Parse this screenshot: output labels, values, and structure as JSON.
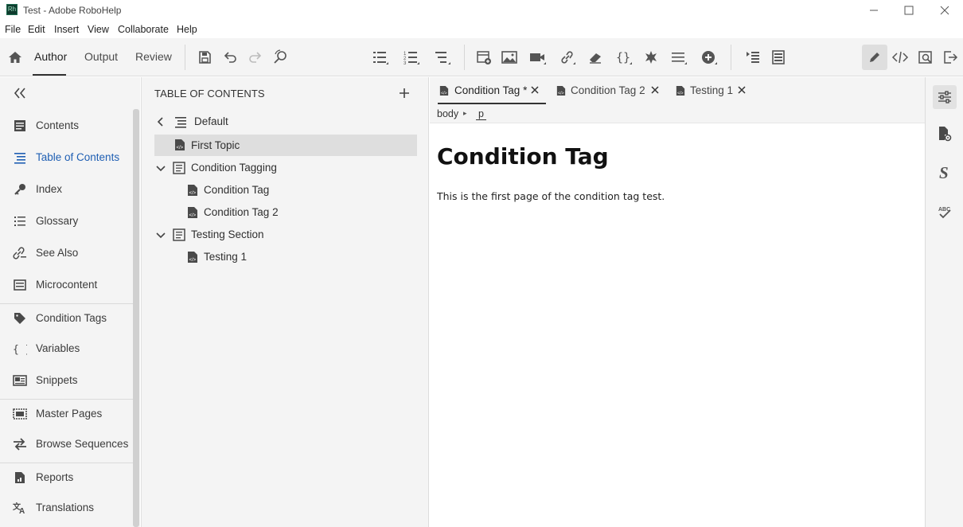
{
  "window": {
    "title": "Test - Adobe RoboHelp",
    "logo_text": "Rh"
  },
  "menu": [
    "File",
    "Edit",
    "Insert",
    "View",
    "Collaborate",
    "Help"
  ],
  "toolbar": {
    "tabs": [
      "Author",
      "Output",
      "Review"
    ],
    "active_tab": "Author"
  },
  "left_nav": {
    "items": [
      {
        "label": "Contents",
        "icon": "contents-icon"
      },
      {
        "label": "Table of Contents",
        "icon": "toc-icon",
        "active": true
      },
      {
        "label": "Index",
        "icon": "key-icon"
      },
      {
        "label": "Glossary",
        "icon": "glossary-icon"
      },
      {
        "label": "See Also",
        "icon": "see-also-icon"
      },
      {
        "label": "Microcontent",
        "icon": "microcontent-icon"
      },
      {
        "label": "Condition Tags",
        "icon": "tag-icon"
      },
      {
        "label": "Variables",
        "icon": "braces-icon"
      },
      {
        "label": "Snippets",
        "icon": "snippets-icon"
      },
      {
        "label": "Master Pages",
        "icon": "master-pages-icon"
      },
      {
        "label": "Browse Sequences",
        "icon": "browse-sequences-icon"
      },
      {
        "label": "Reports",
        "icon": "reports-icon"
      },
      {
        "label": "Translations",
        "icon": "translations-icon"
      }
    ],
    "active_color": "#1f5fb3"
  },
  "toc_panel": {
    "title": "TABLE OF CONTENTS",
    "root": "Default",
    "rows": [
      {
        "label": "First Topic",
        "type": "topic",
        "level": 0,
        "selected": true
      },
      {
        "label": "Condition Tagging",
        "type": "book",
        "level": 0,
        "expanded": true
      },
      {
        "label": "Condition Tag",
        "type": "topic",
        "level": 1
      },
      {
        "label": "Condition Tag 2",
        "type": "topic",
        "level": 1
      },
      {
        "label": "Testing Section",
        "type": "book",
        "level": 0,
        "expanded": true
      },
      {
        "label": "Testing 1",
        "type": "topic",
        "level": 1
      }
    ]
  },
  "editor": {
    "tabs": [
      {
        "label": "Condition Tag *",
        "active": true
      },
      {
        "label": "Condition Tag 2",
        "active": false
      },
      {
        "label": "Testing 1",
        "active": false
      }
    ],
    "breadcrumb": [
      "body",
      "p"
    ],
    "heading": "Condition Tag",
    "paragraph": "This is the first page of the condition tag test."
  }
}
